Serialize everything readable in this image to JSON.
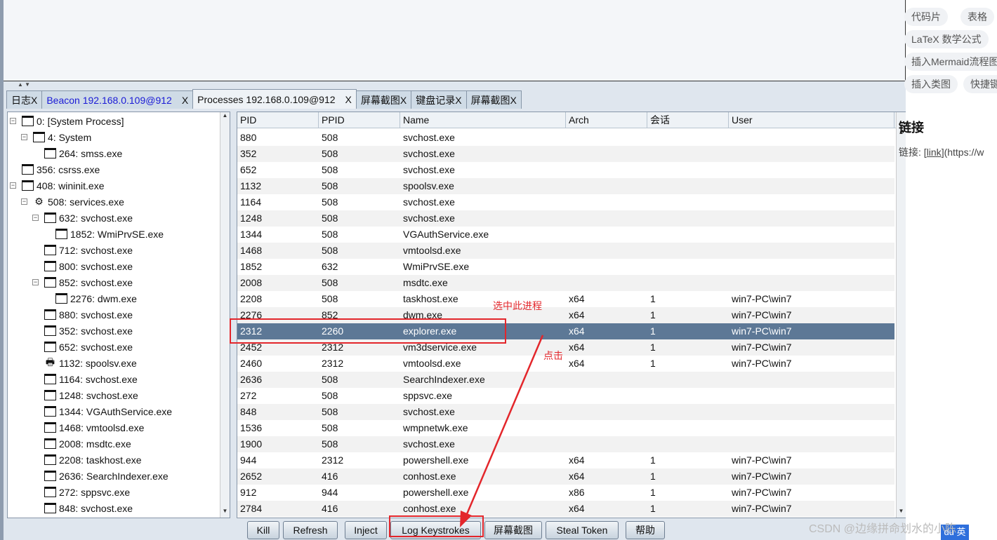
{
  "tabs": [
    {
      "label": "日志X"
    },
    {
      "label": "Beacon 192.168.0.109@912",
      "close": "X"
    },
    {
      "label": "Processes 192.168.0.109@912",
      "close": "X"
    },
    {
      "label": "屏幕截图X"
    },
    {
      "label": "键盘记录X"
    },
    {
      "label": "屏幕截图X"
    }
  ],
  "tree": [
    {
      "label": "0: [System Process]",
      "depth": 0,
      "exp": true,
      "icon": "window"
    },
    {
      "label": "4: System",
      "depth": 1,
      "exp": true,
      "icon": "window"
    },
    {
      "label": "264: smss.exe",
      "depth": 2,
      "icon": "window"
    },
    {
      "label": "356: csrss.exe",
      "depth": 0,
      "icon": "window"
    },
    {
      "label": "408: wininit.exe",
      "depth": 0,
      "exp": true,
      "icon": "window"
    },
    {
      "label": "508: services.exe",
      "depth": 1,
      "exp": true,
      "icon": "gear"
    },
    {
      "label": "632: svchost.exe",
      "depth": 2,
      "exp": true,
      "icon": "window"
    },
    {
      "label": "1852: WmiPrvSE.exe",
      "depth": 3,
      "icon": "window"
    },
    {
      "label": "712: svchost.exe",
      "depth": 2,
      "icon": "window"
    },
    {
      "label": "800: svchost.exe",
      "depth": 2,
      "icon": "window"
    },
    {
      "label": "852: svchost.exe",
      "depth": 2,
      "exp": true,
      "icon": "window"
    },
    {
      "label": "2276: dwm.exe",
      "depth": 3,
      "icon": "window"
    },
    {
      "label": "880: svchost.exe",
      "depth": 2,
      "icon": "window"
    },
    {
      "label": "352: svchost.exe",
      "depth": 2,
      "icon": "window"
    },
    {
      "label": "652: svchost.exe",
      "depth": 2,
      "icon": "window"
    },
    {
      "label": "1132: spoolsv.exe",
      "depth": 2,
      "icon": "printer"
    },
    {
      "label": "1164: svchost.exe",
      "depth": 2,
      "icon": "window"
    },
    {
      "label": "1248: svchost.exe",
      "depth": 2,
      "icon": "window"
    },
    {
      "label": "1344: VGAuthService.exe",
      "depth": 2,
      "icon": "window"
    },
    {
      "label": "1468: vmtoolsd.exe",
      "depth": 2,
      "icon": "window"
    },
    {
      "label": "2008: msdtc.exe",
      "depth": 2,
      "icon": "window"
    },
    {
      "label": "2208: taskhost.exe",
      "depth": 2,
      "icon": "window"
    },
    {
      "label": "2636: SearchIndexer.exe",
      "depth": 2,
      "icon": "window"
    },
    {
      "label": "272: sppsvc.exe",
      "depth": 2,
      "icon": "window"
    },
    {
      "label": "848: svchost.exe",
      "depth": 2,
      "icon": "window"
    }
  ],
  "table": {
    "columns": [
      "PID",
      "PPID",
      "Name",
      "Arch",
      "会话",
      "User"
    ],
    "rows": [
      [
        "880",
        "508",
        "svchost.exe",
        "",
        "",
        ""
      ],
      [
        "352",
        "508",
        "svchost.exe",
        "",
        "",
        ""
      ],
      [
        "652",
        "508",
        "svchost.exe",
        "",
        "",
        ""
      ],
      [
        "1132",
        "508",
        "spoolsv.exe",
        "",
        "",
        ""
      ],
      [
        "1164",
        "508",
        "svchost.exe",
        "",
        "",
        ""
      ],
      [
        "1248",
        "508",
        "svchost.exe",
        "",
        "",
        ""
      ],
      [
        "1344",
        "508",
        "VGAuthService.exe",
        "",
        "",
        ""
      ],
      [
        "1468",
        "508",
        "vmtoolsd.exe",
        "",
        "",
        ""
      ],
      [
        "1852",
        "632",
        "WmiPrvSE.exe",
        "",
        "",
        ""
      ],
      [
        "2008",
        "508",
        "msdtc.exe",
        "",
        "",
        ""
      ],
      [
        "2208",
        "508",
        "taskhost.exe",
        "x64",
        "1",
        "win7-PC\\win7"
      ],
      [
        "2276",
        "852",
        "dwm.exe",
        "x64",
        "1",
        "win7-PC\\win7"
      ],
      [
        "2312",
        "2260",
        "explorer.exe",
        "x64",
        "1",
        "win7-PC\\win7"
      ],
      [
        "2452",
        "2312",
        "vm3dservice.exe",
        "x64",
        "1",
        "win7-PC\\win7"
      ],
      [
        "2460",
        "2312",
        "vmtoolsd.exe",
        "x64",
        "1",
        "win7-PC\\win7"
      ],
      [
        "2636",
        "508",
        "SearchIndexer.exe",
        "",
        "",
        ""
      ],
      [
        "272",
        "508",
        "sppsvc.exe",
        "",
        "",
        ""
      ],
      [
        "848",
        "508",
        "svchost.exe",
        "",
        "",
        ""
      ],
      [
        "1536",
        "508",
        "wmpnetwk.exe",
        "",
        "",
        ""
      ],
      [
        "1900",
        "508",
        "svchost.exe",
        "",
        "",
        ""
      ],
      [
        "944",
        "2312",
        "powershell.exe",
        "x64",
        "1",
        "win7-PC\\win7"
      ],
      [
        "2652",
        "416",
        "conhost.exe",
        "x64",
        "1",
        "win7-PC\\win7"
      ],
      [
        "912",
        "944",
        "powershell.exe",
        "x86",
        "1",
        "win7-PC\\win7"
      ],
      [
        "2784",
        "416",
        "conhost.exe",
        "x64",
        "1",
        "win7-PC\\win7"
      ]
    ],
    "selected_pid": "2312"
  },
  "buttons": [
    "Kill",
    "Refresh",
    "Inject",
    "Log Keystrokes",
    "屏幕截图",
    "Steal Token",
    "帮助"
  ],
  "annotations": {
    "select": "选中此进程",
    "click": "点击"
  },
  "editor": {
    "chips": [
      "代码片",
      "表格",
      "LaTeX 数学公式",
      "插入Mermaid流程图",
      "插入类图",
      "快捷键"
    ],
    "heading": "链接",
    "link_prefix": "链接: [",
    "link_text": "link",
    "link_suffix": "](https://w"
  },
  "watermark": "CSDN @边缘拼命划水的小陈",
  "colors": {
    "selected_row": "#5d7896",
    "annotation": "#e3262b"
  }
}
